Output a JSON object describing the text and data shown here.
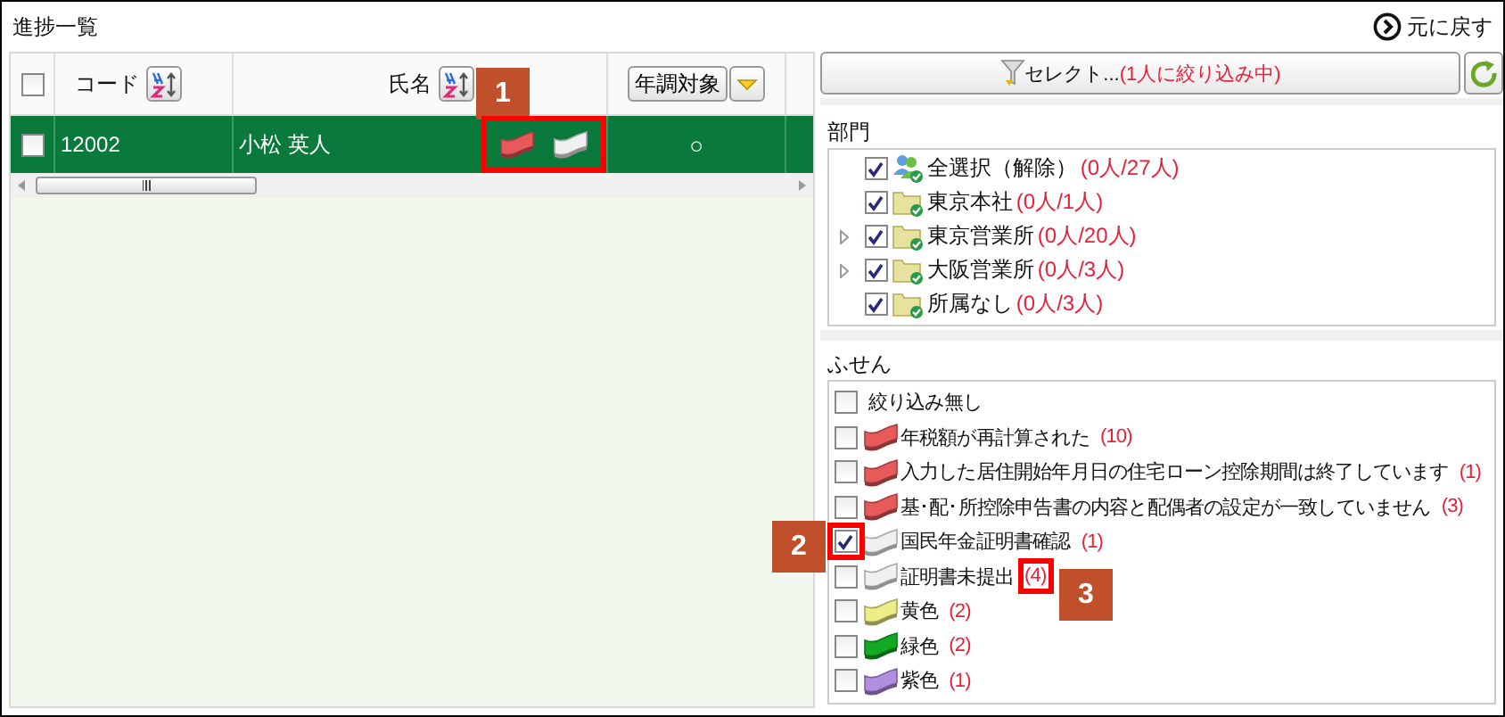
{
  "title": "進捗一覧",
  "back_link": {
    "label": "元に戻す"
  },
  "grid": {
    "header_checked": false,
    "columns": [
      {
        "kind": "check"
      },
      {
        "kind": "sort",
        "label": "コード"
      },
      {
        "kind": "sort",
        "label": "氏名"
      },
      {
        "kind": "filter",
        "label": "年調対象"
      },
      {
        "kind": "cut"
      }
    ],
    "rows": [
      {
        "selected": true,
        "checked": false,
        "code": "12002",
        "name": "小松 英人",
        "flags": [
          {
            "color": "#e85a5a"
          },
          {
            "color": "#f0f0f0"
          }
        ],
        "target": "○"
      }
    ]
  },
  "select_button": {
    "label": "セレクト...",
    "status": "(1人に絞り込み中)"
  },
  "departments": {
    "heading": "部門",
    "items": [
      {
        "kind": "group",
        "label": "全選択（解除）",
        "count": "(0人/27人)",
        "checked": true,
        "collapsed": false
      },
      {
        "kind": "folder",
        "label": "東京本社",
        "count": "(0人/1人)",
        "checked": true,
        "collapsed": false
      },
      {
        "kind": "folder",
        "label": "東京営業所",
        "count": "(0人/20人)",
        "checked": true,
        "collapsed": true
      },
      {
        "kind": "folder",
        "label": "大阪営業所",
        "count": "(0人/3人)",
        "checked": true,
        "collapsed": true
      },
      {
        "kind": "folder",
        "label": "所属なし",
        "count": "(0人/3人)",
        "checked": true,
        "collapsed": false
      }
    ]
  },
  "sticky_notes": {
    "heading": "ふせん",
    "items": [
      {
        "kind": "plain",
        "label": "絞り込み無し",
        "checked": false
      },
      {
        "kind": "flag",
        "color": "#e85a5a",
        "label": "年税額が再計算された",
        "count": "(10)",
        "checked": false
      },
      {
        "kind": "flag",
        "color": "#e85a5a",
        "label": "入力した居住開始年月日の住宅ローン控除期間は終了しています",
        "count": "(1)",
        "checked": false
      },
      {
        "kind": "flag",
        "color": "#e85a5a",
        "label": "基･配･所控除申告書の内容と配偶者の設定が一致していません",
        "count": "(3)",
        "checked": false
      },
      {
        "kind": "flag",
        "color": "#f0f0f0",
        "label": "国民年金証明書確認",
        "count": "(1)",
        "checked": true
      },
      {
        "kind": "flag",
        "color": "#f0f0f0",
        "label": "証明書未提出",
        "count": "(4)",
        "checked": false
      },
      {
        "kind": "flag",
        "color": "#eeee88",
        "label": "黄色",
        "count": "(2)",
        "checked": false
      },
      {
        "kind": "flag",
        "color": "#11aa22",
        "label": "緑色",
        "count": "(2)",
        "checked": false
      },
      {
        "kind": "flag",
        "color": "#b18ee0",
        "label": "紫色",
        "count": "(1)",
        "checked": false
      }
    ]
  },
  "callouts": [
    {
      "number": "1"
    },
    {
      "number": "2"
    },
    {
      "number": "3"
    }
  ]
}
